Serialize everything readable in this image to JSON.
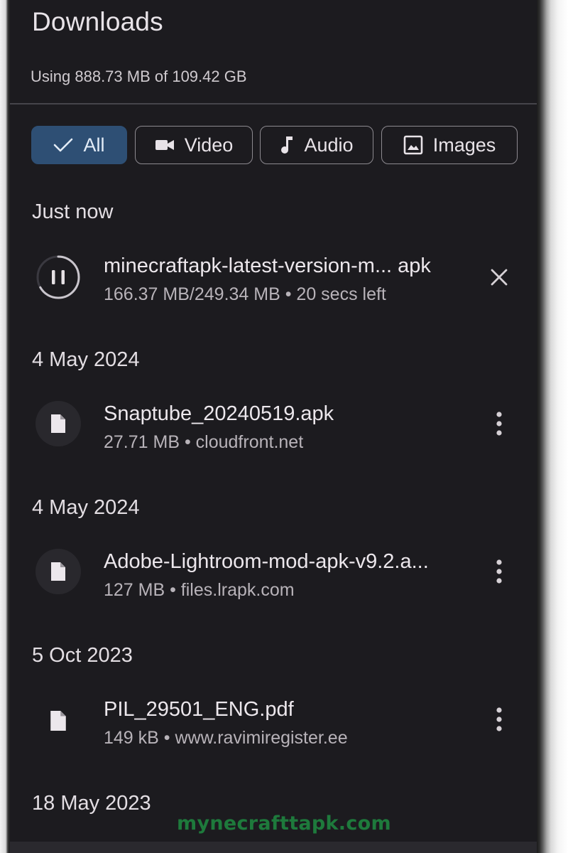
{
  "header": {
    "title": "Downloads",
    "storage_text": "Using 888.73 MB of 109.42 GB"
  },
  "filters": [
    {
      "label": "All",
      "icon": "check-icon",
      "selected": true
    },
    {
      "label": "Video",
      "icon": "video-camera-icon",
      "selected": false
    },
    {
      "label": "Audio",
      "icon": "music-note-icon",
      "selected": false
    },
    {
      "label": "Images",
      "icon": "image-icon",
      "selected": false
    }
  ],
  "sections": [
    {
      "header": "Just now",
      "item": {
        "name": "minecraftapk-latest-version-m... apk",
        "meta": "166.37 MB/249.34 MB • 20 secs left",
        "icon": "pause-icon",
        "action": "close-icon",
        "progress": 0.667
      }
    },
    {
      "header": "4 May 2024",
      "item": {
        "name": "Snaptube_20240519.apk",
        "meta": "27.71 MB • cloudfront.net",
        "icon": "file-icon",
        "action": "more-vert-icon"
      }
    },
    {
      "header": "4 May 2024",
      "item": {
        "name": "Adobe-Lightroom-mod-apk-v9.2.a...",
        "meta": "127 MB • files.lrapk.com",
        "icon": "file-icon",
        "action": "more-vert-icon"
      }
    },
    {
      "header": "5 Oct 2023",
      "item": {
        "name": "PIL_29501_ENG.pdf",
        "meta": "149 kB • www.ravimiregister.ee",
        "icon": "file-icon",
        "action": "more-vert-icon"
      }
    },
    {
      "header": "18 May 2023"
    }
  ],
  "watermark": "mynecrafttapk.com",
  "colors": {
    "background": "#1c1b1f",
    "selected_chip": "#2e4f74",
    "watermark": "#1e7a3c"
  }
}
